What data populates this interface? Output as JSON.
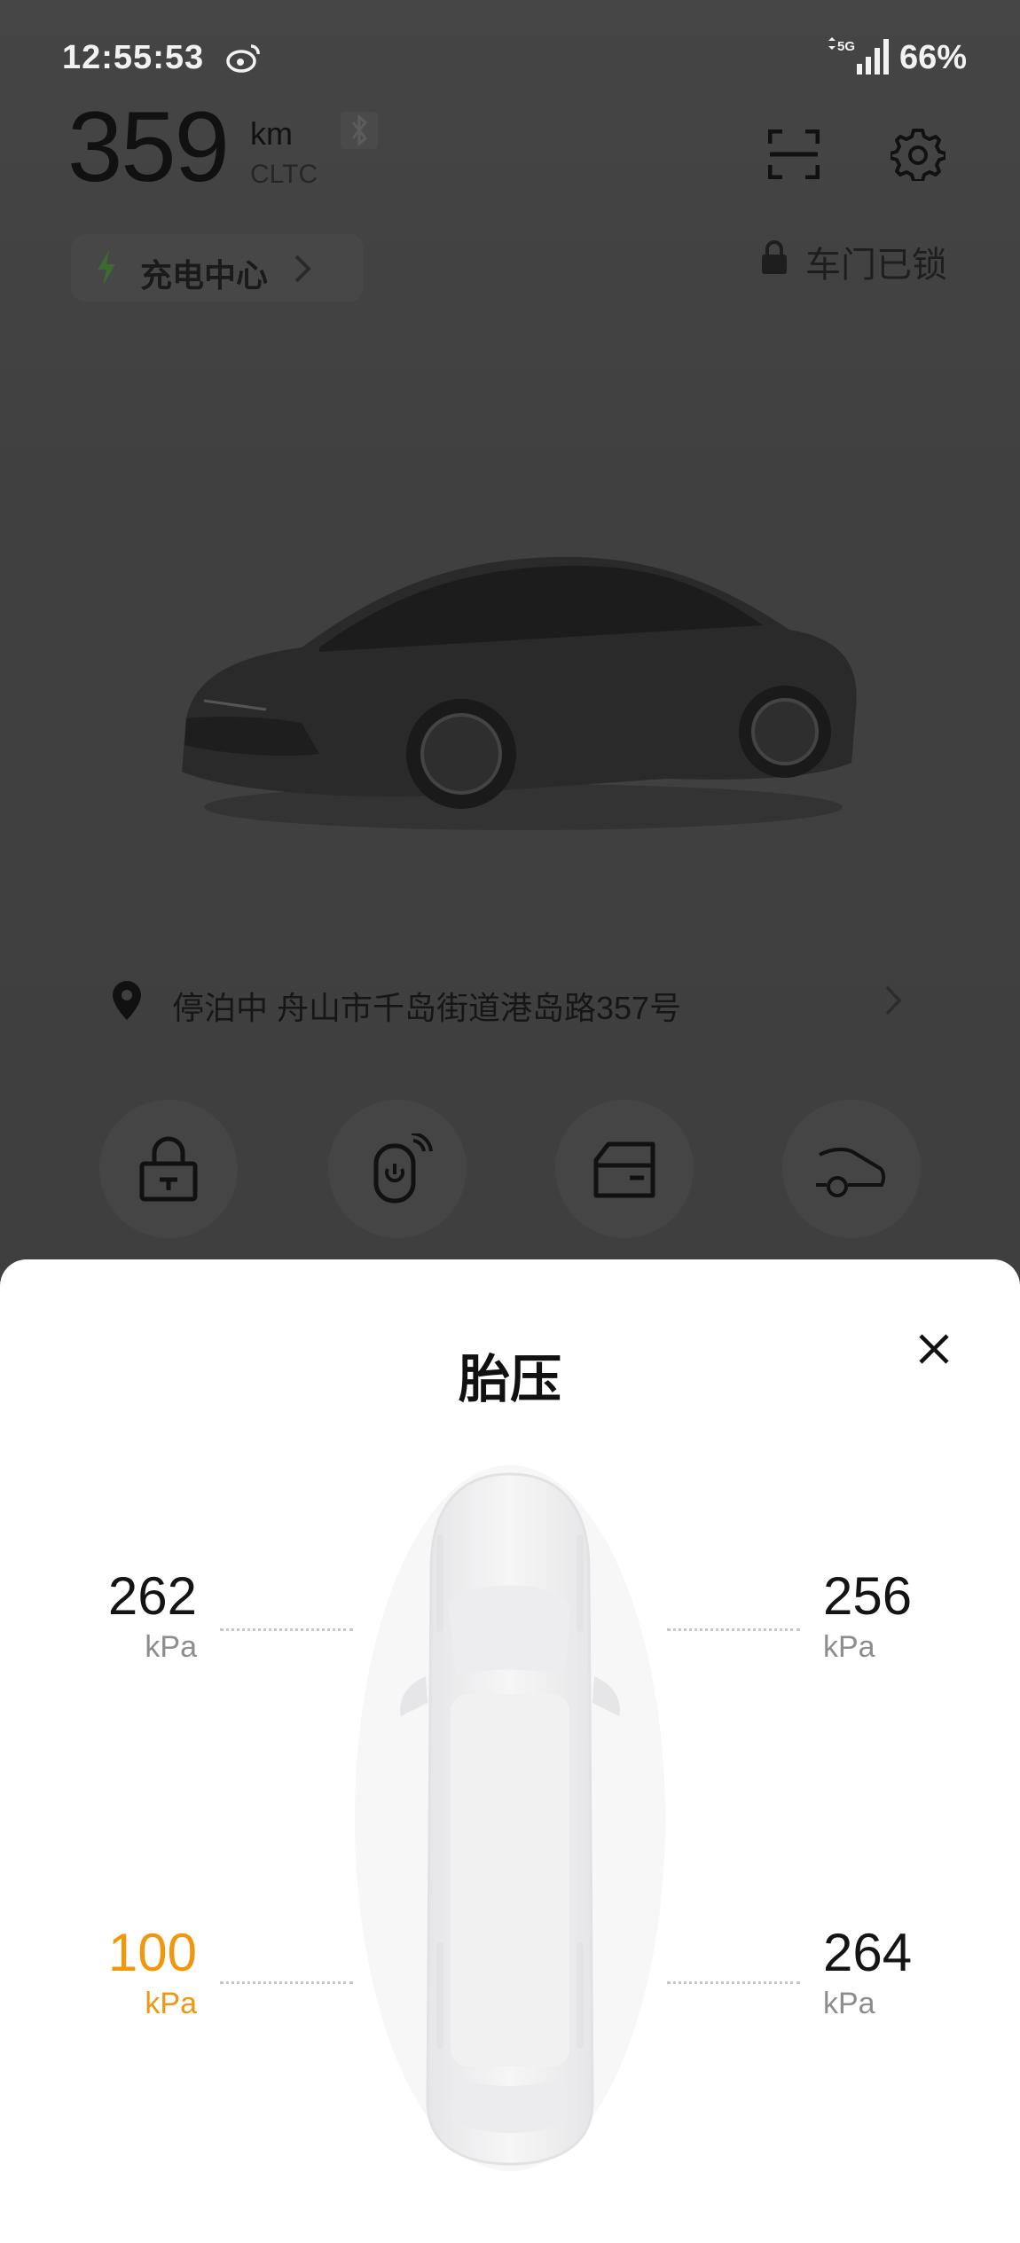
{
  "status_bar": {
    "time": "12:55:53",
    "network": "5G",
    "battery": "66%"
  },
  "vehicle": {
    "range_value": "359",
    "range_unit": "km",
    "range_standard": "CLTC",
    "charge_center_label": "充电中心",
    "door_status": "车门已锁",
    "location": "停泊中 舟山市千岛街道港岛路357号"
  },
  "quick_actions": [
    {
      "icon": "lock-icon"
    },
    {
      "icon": "remote-start-icon"
    },
    {
      "icon": "trunk-icon"
    },
    {
      "icon": "car-power-icon"
    }
  ],
  "sheet": {
    "title": "胎压",
    "tires": {
      "front_left": {
        "value": "262",
        "unit": "kPa",
        "warning": false
      },
      "front_right": {
        "value": "256",
        "unit": "kPa",
        "warning": false
      },
      "rear_left": {
        "value": "100",
        "unit": "kPa",
        "warning": true
      },
      "rear_right": {
        "value": "264",
        "unit": "kPa",
        "warning": false
      }
    }
  },
  "colors": {
    "warning": "#f0970e",
    "sheet_bg": "#ffffff",
    "dim_bg": "#404040"
  }
}
